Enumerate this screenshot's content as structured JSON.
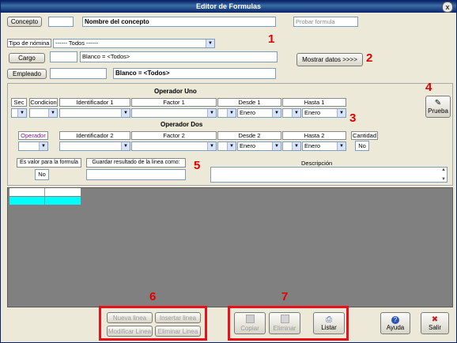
{
  "window": {
    "title": "Editor de Formulas",
    "close_glyph": "x"
  },
  "concepto": {
    "button": "Concepto",
    "code": "",
    "name": "Nombre del concepto",
    "probar_placeholder": "Probar formula"
  },
  "nomina": {
    "label": "Tipo de nómina",
    "value": "------ Todos ------"
  },
  "cargo": {
    "button": "Cargo",
    "code": "",
    "value": "Blanco = <Todos>"
  },
  "empleado": {
    "button": "Empleado",
    "code": "",
    "value": "Blanco   = <Todos>"
  },
  "mostrar_button": "Mostrar datos >>>>",
  "prueba_button": "Prueba",
  "op1": {
    "title": "Operador Uno",
    "headers": {
      "sec": "Sec",
      "condicion": "Condicion",
      "ident": "Identificador 1",
      "factor": "Factor 1",
      "desde": "Desde 1",
      "hasta": "Hasta 1"
    },
    "desde_value": "Enero",
    "hasta_value": "Enero"
  },
  "op2": {
    "title": "Operador Dos",
    "headers": {
      "operador": "Operador",
      "ident": "Identificador 2",
      "factor": "Factor 2",
      "desde": "Desde 2",
      "hasta": "Hasta 2",
      "cantidad": "Cantidad"
    },
    "desde_value": "Enero",
    "hasta_value": "Enero",
    "cantidad_value": "No"
  },
  "bottom_row": {
    "es_valor": "Es valor para la formula",
    "es_valor_value": "No",
    "guardar": "Guardar resultado de la linea como:",
    "descripcion": "Descripción"
  },
  "line_buttons": {
    "nueva": "Nueva linea",
    "insertar": "Insertar linea",
    "modificar": "Modificar Linea",
    "eliminar": "Eliminar Linea"
  },
  "action_buttons": {
    "copiar": "Copiar",
    "eliminar": "Eliminar",
    "listar": "Listar"
  },
  "help_buttons": {
    "ayuda": "Ayuda",
    "salir": "Salir"
  },
  "annotations": [
    "1",
    "2",
    "3",
    "4",
    "5",
    "6",
    "7"
  ],
  "colors": {
    "title_bar": "#0a246a",
    "grid_selection": "#00ffff",
    "annotation_red": "#e8101a",
    "grid_background": "#808080"
  },
  "icons": {
    "prueba": "magic-wand-icon",
    "copiar": "copy-icon",
    "eliminar": "delete-icon",
    "listar": "printer-icon",
    "ayuda": "help-icon",
    "salir": "exit-icon"
  }
}
